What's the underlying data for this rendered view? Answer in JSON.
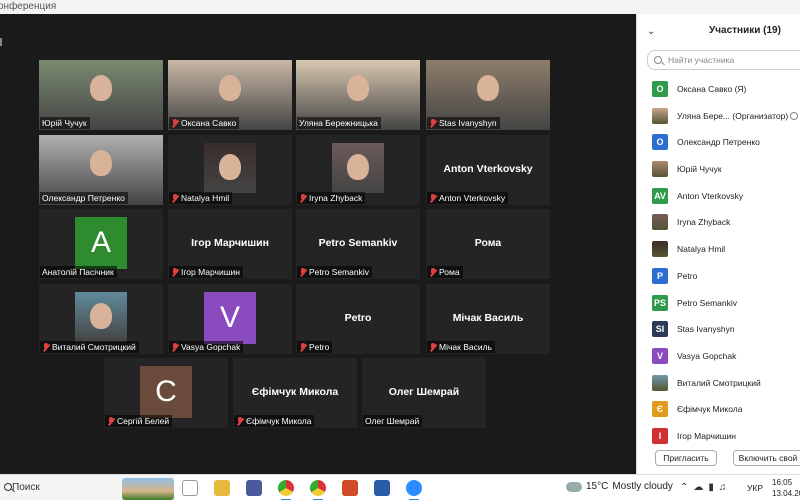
{
  "window": {
    "title": "онференция"
  },
  "tiles": [
    {
      "id": "t1",
      "name": "Юрій Чучук",
      "muted": false,
      "kind": "photo",
      "photoColor": "#7a8a70",
      "active": false
    },
    {
      "id": "t2",
      "name": "Оксана Савко",
      "muted": true,
      "kind": "photo",
      "photoColor": "#c9b8a6",
      "active": false
    },
    {
      "id": "t3",
      "name": "Уляна Бережницька",
      "muted": false,
      "kind": "photo",
      "photoColor": "#d9c8b0",
      "active": true
    },
    {
      "id": "t4",
      "name": "Stas Ivanyshyn",
      "muted": true,
      "kind": "photo",
      "photoColor": "#8d7d6a",
      "active": false
    },
    {
      "id": "t5",
      "name": "Олександр Петренко",
      "muted": false,
      "kind": "photo",
      "photoColor": "#b0b0b0",
      "active": false
    },
    {
      "id": "t6",
      "name": "Natalya Hmil",
      "muted": true,
      "kind": "photo",
      "photoColor": "#3a2c2c",
      "active": false
    },
    {
      "id": "t7",
      "name": "Iryna Zhyback",
      "muted": true,
      "kind": "photo",
      "photoColor": "#6b5a5a",
      "active": false
    },
    {
      "id": "t8",
      "name": "Anton Vterkovsky",
      "muted": true,
      "kind": "text",
      "bigText": "Anton Vterkovsky",
      "active": false
    },
    {
      "id": "t9",
      "name": "Анатолій Пасічник",
      "muted": false,
      "kind": "avatar",
      "letter": "A",
      "color": "#2e8b2e",
      "active": false
    },
    {
      "id": "t10",
      "name": "Ігор Марчишин",
      "muted": true,
      "kind": "text",
      "bigText": "Ігор Марчишин",
      "active": false
    },
    {
      "id": "t11",
      "name": "Petro Semankiv",
      "muted": true,
      "kind": "text",
      "bigText": "Petro Semankiv",
      "active": false
    },
    {
      "id": "t12",
      "name": "Рома",
      "muted": true,
      "kind": "text",
      "bigText": "Рома",
      "active": false
    },
    {
      "id": "t13",
      "name": "Виталий Смотрицкий",
      "muted": true,
      "kind": "photo",
      "photoColor": "#5f8a9a",
      "active": false
    },
    {
      "id": "t14",
      "name": "Vasya Gopchak",
      "muted": true,
      "kind": "avatar",
      "letter": "V",
      "color": "#8a4bbf",
      "active": false
    },
    {
      "id": "t15",
      "name": "Petro",
      "muted": true,
      "kind": "text",
      "bigText": "Petro",
      "active": false
    },
    {
      "id": "t16",
      "name": "Мічак Василь",
      "muted": true,
      "kind": "text",
      "bigText": "Мічак Василь",
      "active": false
    },
    {
      "id": "t17",
      "name": "Сергій Белей",
      "muted": true,
      "kind": "avatar",
      "letter": "C",
      "color": "#6a4a3a",
      "active": false
    },
    {
      "id": "t18",
      "name": "Єфімчук Микола",
      "muted": true,
      "kind": "text",
      "bigText": "Єфімчук Микола",
      "active": false
    },
    {
      "id": "t19",
      "name": "Олег Шемрай",
      "muted": false,
      "kind": "text",
      "bigText": "Олег Шемрай",
      "active": false
    }
  ],
  "panel": {
    "title": "Участники (19)",
    "search_placeholder": "Найти участника",
    "participants": [
      {
        "name": "Оксана Савко (Я)",
        "letter": "O",
        "color": "#2e9a4a"
      },
      {
        "name": "Уляна Бере... (Организатор)",
        "letter": "",
        "color": "#c9a48a",
        "photo": true,
        "extra": true
      },
      {
        "name": "Олександр Петренко",
        "letter": "O",
        "color": "#2d6fd0"
      },
      {
        "name": "Юрій Чучук",
        "letter": "",
        "color": "#b08a70",
        "photo": true
      },
      {
        "name": "Anton Vterkovsky",
        "letter": "AV",
        "color": "#2e9a4a"
      },
      {
        "name": "Iryna Zhyback",
        "letter": "",
        "color": "#7a5a5a",
        "photo": true
      },
      {
        "name": "Natalya Hmil",
        "letter": "",
        "color": "#3a2a2a",
        "photo": true
      },
      {
        "name": "Petro",
        "letter": "P",
        "color": "#2d6fd0"
      },
      {
        "name": "Petro Semankiv",
        "letter": "PS",
        "color": "#2e9a4a"
      },
      {
        "name": "Stas Ivanyshyn",
        "letter": "SI",
        "color": "#2b3a55"
      },
      {
        "name": "Vasya Gopchak",
        "letter": "V",
        "color": "#8a4bbf"
      },
      {
        "name": "Виталий Смотрицкий",
        "letter": "",
        "color": "#6f98a8",
        "photo": true
      },
      {
        "name": "Єфімчук Микола",
        "letter": "Є",
        "color": "#e09a1a"
      },
      {
        "name": "Ігор Марчишин",
        "letter": "I",
        "color": "#d03030"
      }
    ],
    "invite_label": "Пригласить",
    "unmute_label": "Включить свой"
  },
  "taskbar": {
    "search_label": "Поиск",
    "temperature": "15°C",
    "weather": "Mostly cloudy",
    "lang": "УКР",
    "time": "16:05",
    "date": "13.04.202"
  }
}
